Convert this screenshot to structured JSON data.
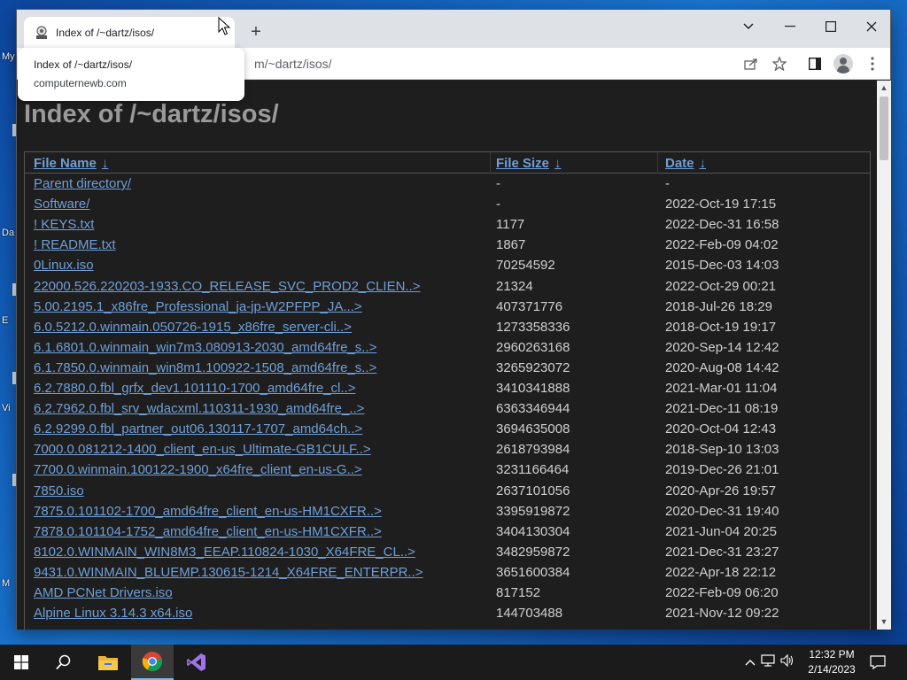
{
  "desktop": {
    "icon_labels": [
      "My",
      "Da",
      "E",
      "Vi",
      "M"
    ]
  },
  "tab": {
    "title": "Index of /~dartz/isos/"
  },
  "hovercard": {
    "title": "Index of /~dartz/isos/",
    "domain": "computernewb.com"
  },
  "address_bar": {
    "visible_url": "m/~dartz/isos/"
  },
  "page": {
    "title": "Index of /~dartz/isos/",
    "columns": [
      "File Name",
      "File Size",
      "Date"
    ],
    "sort_arrow": "↓",
    "rows": [
      {
        "name": "Parent directory/",
        "size": "-",
        "date": "-"
      },
      {
        "name": "Software/",
        "size": "-",
        "date": "2022-Oct-19 17:15"
      },
      {
        "name": "! KEYS.txt",
        "size": "1177",
        "date": "2022-Dec-31 16:58"
      },
      {
        "name": "! README.txt",
        "size": "1867",
        "date": "2022-Feb-09 04:02"
      },
      {
        "name": "0Linux.iso",
        "size": "70254592",
        "date": "2015-Dec-03 14:03"
      },
      {
        "name": "22000.526.220203-1933.CO_RELEASE_SVC_PROD2_CLIEN..>",
        "size": "21324",
        "date": "2022-Oct-29 00:21"
      },
      {
        "name": "5.00.2195.1_x86fre_Professional_ja-jp-W2PFPP_JA...>",
        "size": "407371776",
        "date": "2018-Jul-26 18:29"
      },
      {
        "name": "6.0.5212.0.winmain.050726-1915_x86fre_server-cli..>",
        "size": "1273358336",
        "date": "2018-Oct-19 19:17"
      },
      {
        "name": "6.1.6801.0.winmain_win7m3.080913-2030_amd64fre_s..>",
        "size": "2960263168",
        "date": "2020-Sep-14 12:42"
      },
      {
        "name": "6.1.7850.0.winmain_win8m1.100922-1508_amd64fre_s..>",
        "size": "3265923072",
        "date": "2020-Aug-08 14:42"
      },
      {
        "name": "6.2.7880.0.fbl_grfx_dev1.101110-1700_amd64fre_cl..>",
        "size": "3410341888",
        "date": "2021-Mar-01 11:04"
      },
      {
        "name": "6.2.7962.0.fbl_srv_wdacxml.110311-1930_amd64fre_..>",
        "size": "6363346944",
        "date": "2021-Dec-11 08:19"
      },
      {
        "name": "6.2.9299.0.fbl_partner_out06.130117-1707_amd64ch..>",
        "size": "3694635008",
        "date": "2020-Oct-04 12:43"
      },
      {
        "name": "7000.0.081212-1400_client_en-us_Ultimate-GB1CULF..>",
        "size": "2618793984",
        "date": "2018-Sep-10 13:03"
      },
      {
        "name": "7700.0.winmain.100122-1900_x64fre_client_en-us-G..>",
        "size": "3231166464",
        "date": "2019-Dec-26 21:01"
      },
      {
        "name": "7850.iso",
        "size": "2637101056",
        "date": "2020-Apr-26 19:57"
      },
      {
        "name": "7875.0.101102-1700_amd64fre_client_en-us-HM1CXFR..>",
        "size": "3395919872",
        "date": "2020-Dec-31 19:40"
      },
      {
        "name": "7878.0.101104-1752_amd64fre_client_en-us-HM1CXFR..>",
        "size": "3404130304",
        "date": "2021-Jun-04 20:25"
      },
      {
        "name": "8102.0.WINMAIN_WIN8M3_EEAP.110824-1030_X64FRE_CL..>",
        "size": "3482959872",
        "date": "2021-Dec-31 23:27"
      },
      {
        "name": "9431.0.WINMAIN_BLUEMP.130615-1214_X64FRE_ENTERPR..>",
        "size": "3651600384",
        "date": "2022-Apr-18 22:12"
      },
      {
        "name": "AMD PCNet Drivers.iso",
        "size": "817152",
        "date": "2022-Feb-09 06:20"
      },
      {
        "name": "Alpine Linux 3.14.3 x64.iso",
        "size": "144703488",
        "date": "2021-Nov-12 09:22"
      }
    ]
  },
  "taskbar": {
    "time": "12:32 PM",
    "date": "2/14/2023"
  },
  "colors": {
    "link": "#6f9fd8",
    "page_bg": "#1e1e1e",
    "title": "#9a9a9a"
  }
}
